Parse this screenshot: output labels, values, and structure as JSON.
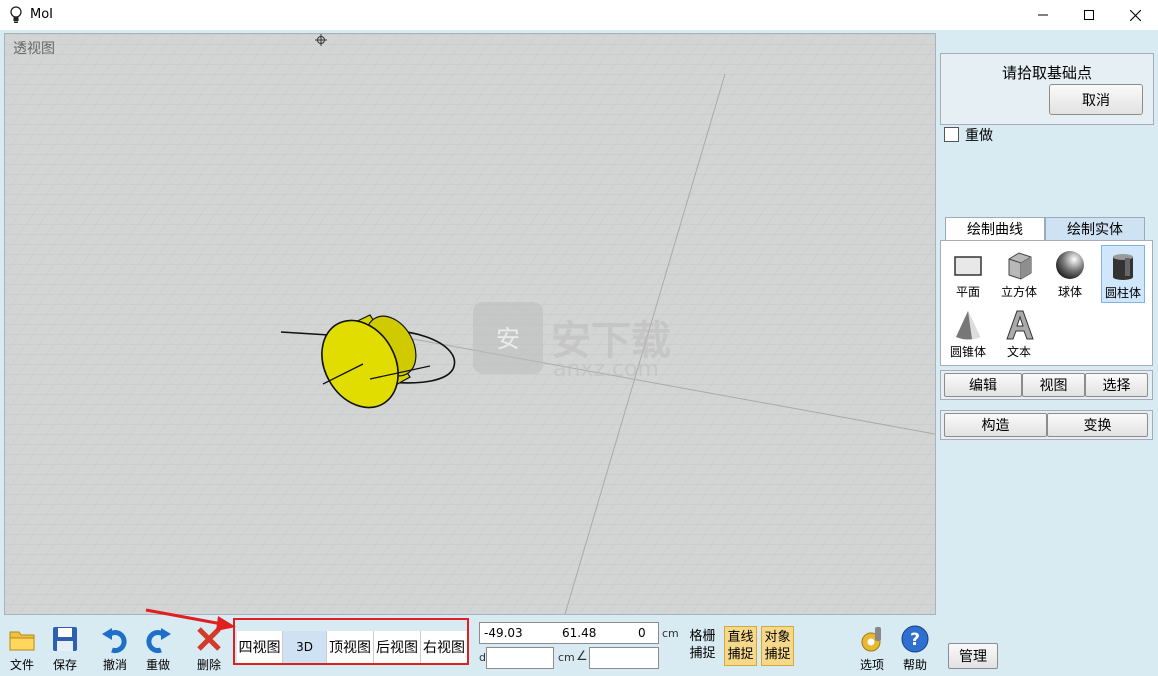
{
  "window": {
    "title": "MoI",
    "minimize": "—",
    "maximize": "☐",
    "close": "✕"
  },
  "viewport": {
    "label": "透视图"
  },
  "watermark": {
    "cn": "安下载",
    "url": "anxz.com"
  },
  "prompt": {
    "text": "请拾取基础点",
    "cancel": "取消"
  },
  "redo_option": {
    "label": "重做",
    "checked": false
  },
  "tabs": [
    {
      "label": "绘制曲线",
      "active": false
    },
    {
      "label": "绘制实体",
      "active": true
    }
  ],
  "tools": [
    {
      "label": "平面",
      "icon": "plane-icon",
      "selected": false
    },
    {
      "label": "立方体",
      "icon": "cube-icon",
      "selected": false
    },
    {
      "label": "球体",
      "icon": "sphere-icon",
      "selected": false
    },
    {
      "label": "圆柱体",
      "icon": "cylinder-icon",
      "selected": true
    },
    {
      "label": "圆锥体",
      "icon": "cone-icon",
      "selected": false
    },
    {
      "label": "文本",
      "icon": "text-icon",
      "selected": false
    }
  ],
  "row1": [
    "编辑",
    "视图",
    "选择"
  ],
  "row2": [
    "构造",
    "变换"
  ],
  "bottom_tools": [
    {
      "label": "文件",
      "icon": "folder-icon"
    },
    {
      "label": "保存",
      "icon": "save-icon"
    },
    {
      "label": "撤消",
      "icon": "undo-icon"
    },
    {
      "label": "重做",
      "icon": "redo-icon"
    },
    {
      "label": "删除",
      "icon": "delete-icon"
    }
  ],
  "views": [
    {
      "label": "四视图",
      "active": false
    },
    {
      "label": "3D",
      "active": true
    },
    {
      "label": "顶视图",
      "active": false
    },
    {
      "label": "后视图",
      "active": false
    },
    {
      "label": "右视图",
      "active": false
    }
  ],
  "coords": {
    "x": "-49.03",
    "y": "61.48",
    "z": "0",
    "unit": "cm",
    "d_label": "d",
    "d_value": "",
    "d_unit": "cm",
    "angle_symbol": "∠",
    "angle_value": ""
  },
  "snaps": [
    {
      "label": "格栅捕捉",
      "line1": "格栅",
      "line2": "捕捉",
      "on": false
    },
    {
      "label": "直线捕捉",
      "line1": "直线",
      "line2": "捕捉",
      "on": true
    },
    {
      "label": "对象捕捉",
      "line1": "对象",
      "line2": "捕捉",
      "on": true
    }
  ],
  "options": {
    "label": "选项",
    "icon": "options-icon"
  },
  "help": {
    "label": "帮助",
    "icon": "help-icon"
  },
  "manage": {
    "label": "管理"
  },
  "colors": {
    "accent": "#1e6fc8",
    "highlight": "#f6d88a",
    "annotation": "#e02020",
    "cylinder": "#d8d400"
  }
}
